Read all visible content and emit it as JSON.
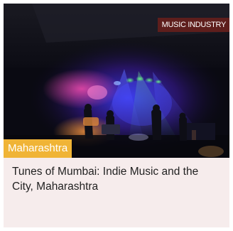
{
  "card": {
    "category": "MUSIC INDUSTRY",
    "location": "Maharashtra",
    "title": "Tunes of Mumbai: Indie Music and the City, Maharashtra",
    "image_alt": "photo-concert-stage"
  },
  "colors": {
    "card_background": "#f6ecec",
    "category_badge": "#5e1e1c",
    "location_tag": "#f0b436",
    "title_text": "#222222"
  }
}
